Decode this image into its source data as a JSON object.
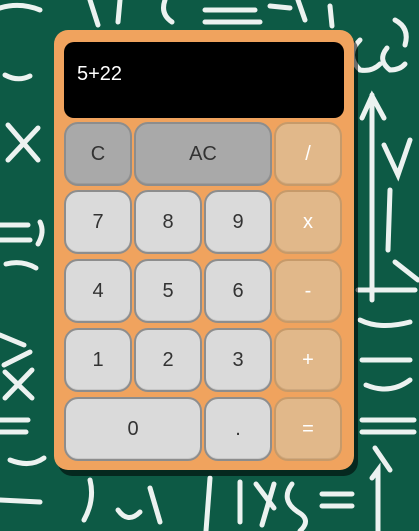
{
  "display": {
    "value": "5+22"
  },
  "keys": {
    "clear": "C",
    "all_clear": "AC",
    "divide": "/",
    "seven": "7",
    "eight": "8",
    "nine": "9",
    "multiply": "x",
    "four": "4",
    "five": "5",
    "six": "6",
    "subtract": "-",
    "one": "1",
    "two": "2",
    "three": "3",
    "add": "+",
    "zero": "0",
    "decimal": ".",
    "equals": "="
  },
  "background": {
    "style": "green chalkboard with white math chalk scribbles"
  },
  "colors": {
    "body": "#f0a35e",
    "display": "#000000",
    "number_key": "#dadada",
    "function_key": "#a9a9a9",
    "operator_key": "#e1b88a",
    "chalkboard": "#0d5a45"
  }
}
